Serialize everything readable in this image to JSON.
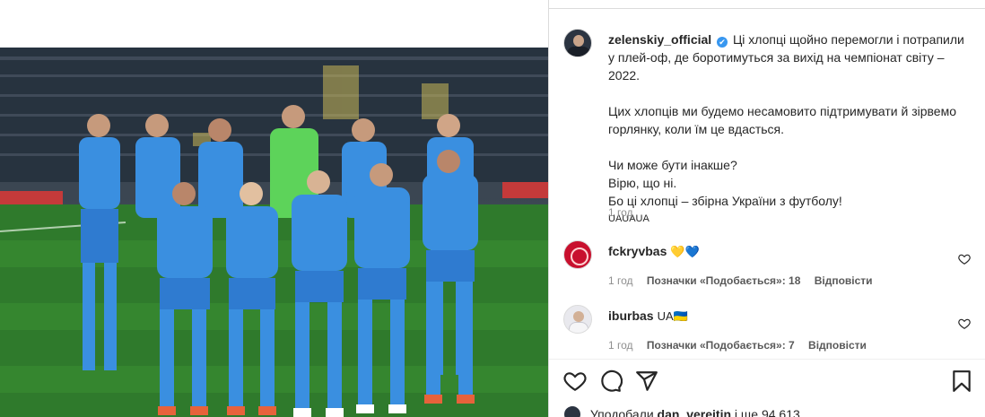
{
  "post": {
    "username": "zelenskiy_official",
    "verified_mark": "✔",
    "caption_line1": "Ці хлопці щойно перемогли і потрапили у плей-оф, де боротимуться за вихід на чемпіонат світу – 2022.",
    "caption_line2": "Цих хлопців ми будемо несамовито підтримувати й зірвемо горлянку, коли їм це вдасться.",
    "caption_line3": "Чи може бути інакше?",
    "caption_line4": "Вірю, що ні.",
    "caption_line5": "Бо ці хлопці – збірна України з футболу!",
    "caption_tag": "UAUAUA",
    "time": "1 год"
  },
  "photo": {
    "description_alt": "",
    "shirt_color": "#3a8fe0",
    "keeper_color": "#5dd35a"
  },
  "comments": [
    {
      "username": "fckryvbas",
      "text": "💛💙",
      "time": "1 год",
      "likes": "Позначки «Подобається»: 18",
      "reply": "Відповісти"
    },
    {
      "username": "iburbas",
      "text": "UA🇺🇦",
      "time": "1 год",
      "likes": "Позначки «Подобається»: 7",
      "reply": "Відповісти"
    }
  ],
  "footer": {
    "likes_prefix": "Уподобали",
    "likes_user": "dan_vereitin",
    "likes_suffix": "і ще 94 613"
  },
  "icons": {
    "like": "heart-icon",
    "comment": "comment-icon",
    "share": "share-icon",
    "save": "bookmark-icon"
  }
}
